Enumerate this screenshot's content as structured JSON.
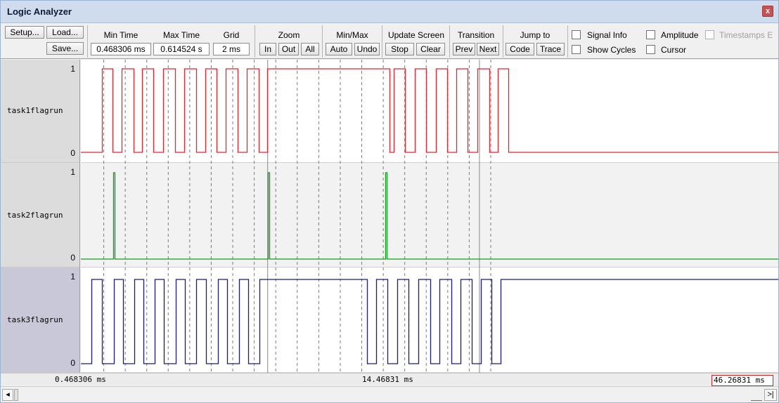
{
  "window": {
    "title": "Logic Analyzer",
    "close_label": "x"
  },
  "toolbar": {
    "setup": "Setup...",
    "load": "Load...",
    "save": "Save...",
    "min_time_label": "Min Time",
    "min_time_value": "0.468306 ms",
    "max_time_label": "Max Time",
    "max_time_value": "0.614524 s",
    "grid_label": "Grid",
    "grid_value": "2 ms",
    "zoom_label": "Zoom",
    "zoom_in": "In",
    "zoom_out": "Out",
    "zoom_all": "All",
    "minmax_label": "Min/Max",
    "auto": "Auto",
    "undo": "Undo",
    "update_label": "Update Screen",
    "stop": "Stop",
    "clear": "Clear",
    "transition_label": "Transition",
    "prev": "Prev",
    "next": "Next",
    "jump_label": "Jump to",
    "code": "Code",
    "trace": "Trace",
    "signal_info": "Signal Info",
    "amplitude": "Amplitude",
    "timestamps": "Timestamps E",
    "show_cycles": "Show Cycles",
    "cursor": "Cursor"
  },
  "signals": [
    {
      "name": "task1flagrun",
      "high": "1",
      "low": "0",
      "color": "#e8242a",
      "transitions_ms": [
        4.1,
        6.1,
        7.8,
        10.0,
        11.6,
        13.7,
        15.5,
        17.7,
        19.4,
        21.6,
        23.3,
        25.5,
        27.2,
        29.4,
        31.1,
        33.3,
        34.9,
        57.6,
        58.4,
        60.5,
        62.3,
        64.4,
        66.2,
        68.3,
        70.1,
        72.2,
        74.0,
        76.2,
        77.8,
        79.8
      ]
    },
    {
      "name": "task2flagrun",
      "high": "1",
      "low": "0",
      "color": "#119c1b",
      "transitions_ms": [
        6.2,
        6.45,
        35.0,
        35.3,
        56.9,
        57.15
      ]
    },
    {
      "name": "task3flagrun",
      "high": "1",
      "low": "0",
      "color": "#1a1a88",
      "transitions_ms": [
        2.2,
        4.1,
        6.3,
        8.0,
        10.1,
        11.8,
        13.9,
        15.7,
        17.9,
        19.6,
        21.7,
        23.5,
        25.7,
        27.4,
        29.6,
        31.3,
        33.4,
        53.4,
        55.1,
        57.3,
        59.1,
        61.2,
        63.0,
        65.2,
        66.9,
        69.1,
        70.8,
        72.9,
        74.6,
        76.6,
        78.3
      ]
    }
  ],
  "view": {
    "start_ms": 0.468306,
    "ms_per_grid": 2,
    "grid_lines_ms": [
      4.4,
      8.4,
      12.4,
      16.4,
      20.4,
      24.4,
      28.4,
      32.4,
      36.4,
      40.4,
      44.4,
      48.4,
      52.4,
      56.4,
      60.4,
      64.4,
      68.4,
      72.4,
      76.4
    ],
    "marker_lines_ms": [
      34.9,
      74.3
    ]
  },
  "timebar": {
    "left": "0.468306 ms",
    "center": "14.46831 ms",
    "right": "46.26831 ms"
  },
  "scroll": {
    "left_arrow": "◂",
    "right_arrow": ">|"
  }
}
